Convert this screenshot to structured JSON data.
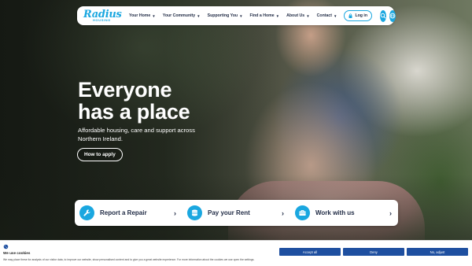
{
  "header": {
    "logo": {
      "word": "Radius",
      "sub": "HOUSING"
    },
    "nav": [
      {
        "label": "Your Home"
      },
      {
        "label": "Your Community"
      },
      {
        "label": "Supporting You"
      },
      {
        "label": "Find a Home"
      },
      {
        "label": "About Us"
      },
      {
        "label": "Contact"
      }
    ],
    "login_label": "Log in"
  },
  "hero": {
    "title_line1": "Everyone",
    "title_line2": "has a place",
    "subtitle": "Affordable housing, care and support across Northern Ireland.",
    "cta_label": "How to apply"
  },
  "quick_links": [
    {
      "label": "Report a Repair",
      "icon": "wrench-icon"
    },
    {
      "label": "Pay your Rent",
      "icon": "coins-icon"
    },
    {
      "label": "Work with us",
      "icon": "briefcase-icon"
    }
  ],
  "cookie_banner": {
    "title": "We use cookies",
    "text": "We may place these for analysis of our visitor data, to improve our website, show personalised content and to give you a great website experience. For more information about the cookies we use open the settings.",
    "accept_label": "Accept all",
    "deny_label": "Deny",
    "adjust_label": "No, adjust"
  },
  "colors": {
    "brand": "#1aa7e0",
    "navy": "#1f2a44",
    "cookie_button": "#1e4fa0"
  }
}
